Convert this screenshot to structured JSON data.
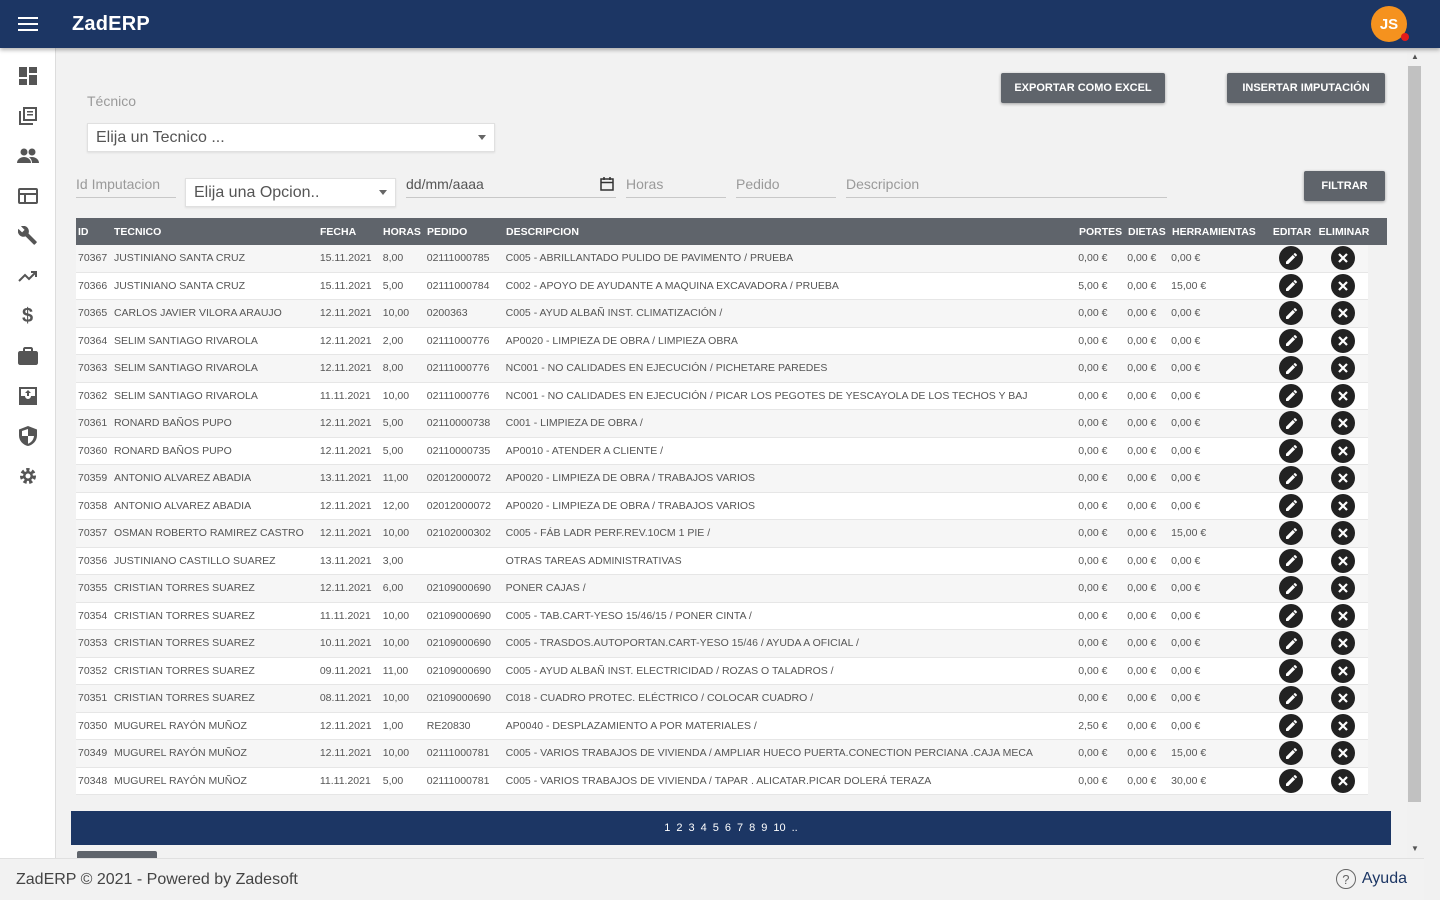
{
  "app": {
    "title": "ZadERP",
    "avatar_initials": "JS"
  },
  "sidebar": {
    "items": [
      {
        "name": "dashboard",
        "icon": "dashboard-icon"
      },
      {
        "name": "library",
        "icon": "library-icon"
      },
      {
        "name": "people",
        "icon": "people-icon"
      },
      {
        "name": "web",
        "icon": "web-icon"
      },
      {
        "name": "build",
        "icon": "wrench-icon"
      },
      {
        "name": "trending",
        "icon": "trending-up-icon"
      },
      {
        "name": "money",
        "icon": "dollar-icon"
      },
      {
        "name": "work",
        "icon": "briefcase-icon"
      },
      {
        "name": "archive",
        "icon": "archive-icon"
      },
      {
        "name": "security",
        "icon": "shield-icon"
      },
      {
        "name": "settings",
        "icon": "gear-icon"
      }
    ]
  },
  "toolbar": {
    "export_label": "EXPORTAR COMO EXCEL",
    "insert_label": "INSERTAR IMPUTACIÓN",
    "filter_label": "FILTRAR"
  },
  "filters": {
    "tecnico_label": "Técnico",
    "tecnico_value": "Elija un Tecnico ...",
    "id_placeholder": "Id Imputacion",
    "opcion_value": "Elija una Opcion..",
    "date_placeholder": "dd/mm/aaaa",
    "horas_placeholder": "Horas",
    "pedido_placeholder": "Pedido",
    "descripcion_placeholder": "Descripcion"
  },
  "table": {
    "headers": {
      "id": "ID",
      "tecnico": "TECNICO",
      "fecha": "FECHA",
      "horas": "HORAS",
      "pedido": "PEDIDO",
      "descripcion": "DESCRIPCION",
      "portes": "PORTES",
      "dietas": "DIETAS",
      "herramientas": "HERRAMIENTAS",
      "editar": "EDITAR",
      "eliminar": "ELIMINAR"
    },
    "rows": [
      {
        "id": "70367",
        "tecnico": "JUSTINIANO SANTA CRUZ",
        "fecha": "15.11.2021",
        "horas": "8,00",
        "pedido": "02111000785",
        "descripcion": "C005 - ABRILLANTADO PULIDO DE PAVIMENTO / PRUEBA",
        "portes": "0,00 €",
        "dietas": "0,00 €",
        "herramientas": "0,00 €"
      },
      {
        "id": "70366",
        "tecnico": "JUSTINIANO SANTA CRUZ",
        "fecha": "15.11.2021",
        "horas": "5,00",
        "pedido": "02111000784",
        "descripcion": "C002 - APOYO DE AYUDANTE A MAQUINA EXCAVADORA / PRUEBA",
        "portes": "5,00 €",
        "dietas": "0,00 €",
        "herramientas": "15,00 €"
      },
      {
        "id": "70365",
        "tecnico": "CARLOS JAVIER VILORA ARAUJO",
        "fecha": "12.11.2021",
        "horas": "10,00",
        "pedido": "0200363",
        "descripcion": "C005 - AYUD ALBAÑ INST. CLIMATIZACIÓN /",
        "portes": "0,00 €",
        "dietas": "0,00 €",
        "herramientas": "0,00 €"
      },
      {
        "id": "70364",
        "tecnico": "SELIM SANTIAGO RIVAROLA",
        "fecha": "12.11.2021",
        "horas": "2,00",
        "pedido": "02111000776",
        "descripcion": "AP0020 - LIMPIEZA DE OBRA / LIMPIEZA OBRA",
        "portes": "0,00 €",
        "dietas": "0,00 €",
        "herramientas": "0,00 €"
      },
      {
        "id": "70363",
        "tecnico": "SELIM SANTIAGO RIVAROLA",
        "fecha": "12.11.2021",
        "horas": "8,00",
        "pedido": "02111000776",
        "descripcion": "NC001 - NO CALIDADES EN EJECUCIÓN / PICHETARE PAREDES",
        "portes": "0,00 €",
        "dietas": "0,00 €",
        "herramientas": "0,00 €"
      },
      {
        "id": "70362",
        "tecnico": "SELIM SANTIAGO RIVAROLA",
        "fecha": "11.11.2021",
        "horas": "10,00",
        "pedido": "02111000776",
        "descripcion": "NC001 - NO CALIDADES EN EJECUCIÓN / PICAR LOS PEGOTES DE YESCAYOLA DE LOS TECHOS Y BAJ",
        "portes": "0,00 €",
        "dietas": "0,00 €",
        "herramientas": "0,00 €"
      },
      {
        "id": "70361",
        "tecnico": "RONARD BAÑOS PUPO",
        "fecha": "12.11.2021",
        "horas": "5,00",
        "pedido": "02110000738",
        "descripcion": "C001 - LIMPIEZA DE OBRA /",
        "portes": "0,00 €",
        "dietas": "0,00 €",
        "herramientas": "0,00 €"
      },
      {
        "id": "70360",
        "tecnico": "RONARD BAÑOS PUPO",
        "fecha": "12.11.2021",
        "horas": "5,00",
        "pedido": "02110000735",
        "descripcion": "AP0010 - ATENDER A CLIENTE /",
        "portes": "0,00 €",
        "dietas": "0,00 €",
        "herramientas": "0,00 €"
      },
      {
        "id": "70359",
        "tecnico": "ANTONIO ALVAREZ ABADIA",
        "fecha": "13.11.2021",
        "horas": "11,00",
        "pedido": "02012000072",
        "descripcion": "AP0020 - LIMPIEZA DE OBRA / TRABAJOS VARIOS",
        "portes": "0,00 €",
        "dietas": "0,00 €",
        "herramientas": "0,00 €"
      },
      {
        "id": "70358",
        "tecnico": "ANTONIO ALVAREZ ABADIA",
        "fecha": "12.11.2021",
        "horas": "12,00",
        "pedido": "02012000072",
        "descripcion": "AP0020 - LIMPIEZA DE OBRA / TRABAJOS VARIOS",
        "portes": "0,00 €",
        "dietas": "0,00 €",
        "herramientas": "0,00 €"
      },
      {
        "id": "70357",
        "tecnico": "OSMAN ROBERTO RAMIREZ CASTRO",
        "fecha": "12.11.2021",
        "horas": "10,00",
        "pedido": "02102000302",
        "descripcion": "C005 - FÁB LADR PERF.REV.10CM 1 PIE /",
        "portes": "0,00 €",
        "dietas": "0,00 €",
        "herramientas": "15,00 €"
      },
      {
        "id": "70356",
        "tecnico": "JUSTINIANO CASTILLO SUAREZ",
        "fecha": "13.11.2021",
        "horas": "3,00",
        "pedido": "",
        "descripcion": "OTRAS TAREAS ADMINISTRATIVAS",
        "portes": "0,00 €",
        "dietas": "0,00 €",
        "herramientas": "0,00 €"
      },
      {
        "id": "70355",
        "tecnico": "CRISTIAN TORRES SUAREZ",
        "fecha": "12.11.2021",
        "horas": "6,00",
        "pedido": "02109000690",
        "descripcion": "PONER CAJAS /",
        "portes": "0,00 €",
        "dietas": "0,00 €",
        "herramientas": "0,00 €"
      },
      {
        "id": "70354",
        "tecnico": "CRISTIAN TORRES SUAREZ",
        "fecha": "11.11.2021",
        "horas": "10,00",
        "pedido": "02109000690",
        "descripcion": "C005 - TAB.CART-YESO 15/46/15 / PONER CINTA /",
        "portes": "0,00 €",
        "dietas": "0,00 €",
        "herramientas": "0,00 €"
      },
      {
        "id": "70353",
        "tecnico": "CRISTIAN TORRES SUAREZ",
        "fecha": "10.11.2021",
        "horas": "10,00",
        "pedido": "02109000690",
        "descripcion": "C005 - TRASDOS.AUTOPORTAN.CART-YESO 15/46 / AYUDA A OFICIAL /",
        "portes": "0,00 €",
        "dietas": "0,00 €",
        "herramientas": "0,00 €"
      },
      {
        "id": "70352",
        "tecnico": "CRISTIAN TORRES SUAREZ",
        "fecha": "09.11.2021",
        "horas": "11,00",
        "pedido": "02109000690",
        "descripcion": "C005 - AYUD ALBAÑ INST. ELECTRICIDAD / ROZAS O TALADROS /",
        "portes": "0,00 €",
        "dietas": "0,00 €",
        "herramientas": "0,00 €"
      },
      {
        "id": "70351",
        "tecnico": "CRISTIAN TORRES SUAREZ",
        "fecha": "08.11.2021",
        "horas": "10,00",
        "pedido": "02109000690",
        "descripcion": "C018 - CUADRO PROTEC. ELÉCTRICO / COLOCAR CUADRO /",
        "portes": "0,00 €",
        "dietas": "0,00 €",
        "herramientas": "0,00 €"
      },
      {
        "id": "70350",
        "tecnico": "MUGUREL RAYÓN MUÑOZ",
        "fecha": "12.11.2021",
        "horas": "1,00",
        "pedido": "RE20830",
        "descripcion": "AP0040 - DESPLAZAMIENTO A POR MATERIALES /",
        "portes": "2,50 €",
        "dietas": "0,00 €",
        "herramientas": "0,00 €"
      },
      {
        "id": "70349",
        "tecnico": "MUGUREL RAYÓN MUÑOZ",
        "fecha": "12.11.2021",
        "horas": "10,00",
        "pedido": "02111000781",
        "descripcion": "C005 - VARIOS TRABAJOS DE VIVIENDA / AMPLIAR HUECO PUERTA.CONECTION PERCIANA .CAJA MECA",
        "portes": "0,00 €",
        "dietas": "0,00 €",
        "herramientas": "15,00 €"
      },
      {
        "id": "70348",
        "tecnico": "MUGUREL RAYÓN MUÑOZ",
        "fecha": "11.11.2021",
        "horas": "5,00",
        "pedido": "02111000781",
        "descripcion": "C005 - VARIOS TRABAJOS DE VIVIENDA / TAPAR . ALICATAR.PICAR DOLERÁ TERAZA",
        "portes": "0,00 €",
        "dietas": "0,00 €",
        "herramientas": "30,00 €"
      }
    ]
  },
  "pagination": {
    "pages": [
      "1",
      "2",
      "3",
      "4",
      "5",
      "6",
      "7",
      "8",
      "9",
      "10",
      ".."
    ]
  },
  "footer": {
    "text": "ZadERP © 2021 - Powered by Zadesoft",
    "help_label": "Ayuda"
  },
  "colors": {
    "primary": "#1c3664",
    "button": "#5f646b",
    "avatar": "#f5921e"
  }
}
